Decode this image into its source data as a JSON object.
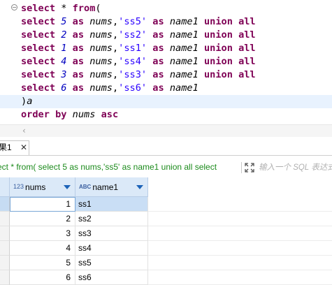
{
  "editor": {
    "lines": [
      [
        {
          "t": "select",
          "c": "kw"
        },
        {
          "t": " * ",
          "c": "op"
        },
        {
          "t": "from",
          "c": "kw"
        },
        {
          "t": "(",
          "c": "op"
        }
      ],
      [
        {
          "t": "select",
          "c": "kw"
        },
        {
          "t": " ",
          "c": "op"
        },
        {
          "t": "5",
          "c": "num"
        },
        {
          "t": " ",
          "c": "op"
        },
        {
          "t": "as",
          "c": "kw"
        },
        {
          "t": " ",
          "c": "op"
        },
        {
          "t": "nums",
          "c": "id"
        },
        {
          "t": ",",
          "c": "op"
        },
        {
          "t": "'ss5'",
          "c": "str"
        },
        {
          "t": " ",
          "c": "op"
        },
        {
          "t": "as",
          "c": "kw"
        },
        {
          "t": " ",
          "c": "op"
        },
        {
          "t": "name1",
          "c": "id"
        },
        {
          "t": " ",
          "c": "op"
        },
        {
          "t": "union",
          "c": "kw"
        },
        {
          "t": " ",
          "c": "op"
        },
        {
          "t": "all",
          "c": "kw"
        }
      ],
      [
        {
          "t": "select",
          "c": "kw"
        },
        {
          "t": " ",
          "c": "op"
        },
        {
          "t": "2",
          "c": "num"
        },
        {
          "t": " ",
          "c": "op"
        },
        {
          "t": "as",
          "c": "kw"
        },
        {
          "t": " ",
          "c": "op"
        },
        {
          "t": "nums",
          "c": "id"
        },
        {
          "t": ",",
          "c": "op"
        },
        {
          "t": "'ss2'",
          "c": "str"
        },
        {
          "t": " ",
          "c": "op"
        },
        {
          "t": "as",
          "c": "kw"
        },
        {
          "t": " ",
          "c": "op"
        },
        {
          "t": "name1",
          "c": "id"
        },
        {
          "t": " ",
          "c": "op"
        },
        {
          "t": "union",
          "c": "kw"
        },
        {
          "t": " ",
          "c": "op"
        },
        {
          "t": "all",
          "c": "kw"
        }
      ],
      [
        {
          "t": "select",
          "c": "kw"
        },
        {
          "t": " ",
          "c": "op"
        },
        {
          "t": "1",
          "c": "num"
        },
        {
          "t": " ",
          "c": "op"
        },
        {
          "t": "as",
          "c": "kw"
        },
        {
          "t": " ",
          "c": "op"
        },
        {
          "t": "nums",
          "c": "id"
        },
        {
          "t": ",",
          "c": "op"
        },
        {
          "t": "'ss1'",
          "c": "str"
        },
        {
          "t": " ",
          "c": "op"
        },
        {
          "t": "as",
          "c": "kw"
        },
        {
          "t": " ",
          "c": "op"
        },
        {
          "t": "name1",
          "c": "id"
        },
        {
          "t": " ",
          "c": "op"
        },
        {
          "t": "union",
          "c": "kw"
        },
        {
          "t": " ",
          "c": "op"
        },
        {
          "t": "all",
          "c": "kw"
        }
      ],
      [
        {
          "t": "select",
          "c": "kw"
        },
        {
          "t": " ",
          "c": "op"
        },
        {
          "t": "4",
          "c": "num"
        },
        {
          "t": " ",
          "c": "op"
        },
        {
          "t": "as",
          "c": "kw"
        },
        {
          "t": " ",
          "c": "op"
        },
        {
          "t": "nums",
          "c": "id"
        },
        {
          "t": ",",
          "c": "op"
        },
        {
          "t": "'ss4'",
          "c": "str"
        },
        {
          "t": " ",
          "c": "op"
        },
        {
          "t": "as",
          "c": "kw"
        },
        {
          "t": " ",
          "c": "op"
        },
        {
          "t": "name1",
          "c": "id"
        },
        {
          "t": " ",
          "c": "op"
        },
        {
          "t": "union",
          "c": "kw"
        },
        {
          "t": " ",
          "c": "op"
        },
        {
          "t": "all",
          "c": "kw"
        }
      ],
      [
        {
          "t": "select",
          "c": "kw"
        },
        {
          "t": " ",
          "c": "op"
        },
        {
          "t": "3",
          "c": "num"
        },
        {
          "t": " ",
          "c": "op"
        },
        {
          "t": "as",
          "c": "kw"
        },
        {
          "t": " ",
          "c": "op"
        },
        {
          "t": "nums",
          "c": "id"
        },
        {
          "t": ",",
          "c": "op"
        },
        {
          "t": "'ss3'",
          "c": "str"
        },
        {
          "t": " ",
          "c": "op"
        },
        {
          "t": "as",
          "c": "kw"
        },
        {
          "t": " ",
          "c": "op"
        },
        {
          "t": "name1",
          "c": "id"
        },
        {
          "t": " ",
          "c": "op"
        },
        {
          "t": "union",
          "c": "kw"
        },
        {
          "t": " ",
          "c": "op"
        },
        {
          "t": "all",
          "c": "kw"
        }
      ],
      [
        {
          "t": "select",
          "c": "kw"
        },
        {
          "t": " ",
          "c": "op"
        },
        {
          "t": "6",
          "c": "num"
        },
        {
          "t": " ",
          "c": "op"
        },
        {
          "t": "as",
          "c": "kw"
        },
        {
          "t": " ",
          "c": "op"
        },
        {
          "t": "nums",
          "c": "id"
        },
        {
          "t": ",",
          "c": "op"
        },
        {
          "t": "'ss6'",
          "c": "str"
        },
        {
          "t": " ",
          "c": "op"
        },
        {
          "t": "as",
          "c": "kw"
        },
        {
          "t": " ",
          "c": "op"
        },
        {
          "t": "name1",
          "c": "id"
        }
      ],
      [
        {
          "t": ")",
          "c": "op"
        },
        {
          "t": "a",
          "c": "id"
        }
      ],
      [
        {
          "t": "order",
          "c": "kw"
        },
        {
          "t": " ",
          "c": "op"
        },
        {
          "t": "by",
          "c": "kw"
        },
        {
          "t": " ",
          "c": "op"
        },
        {
          "t": "nums",
          "c": "id"
        },
        {
          "t": " ",
          "c": "op"
        },
        {
          "t": "asc",
          "c": "kw"
        }
      ]
    ],
    "current_line_index": 7,
    "fold_icon": "fold-collapse-icon",
    "scroll_left_arrow": "‹"
  },
  "result_tab": {
    "label": "果1",
    "close_glyph": "✕"
  },
  "filter_bar": {
    "query_text": "ect * from( select 5 as nums,'ss5' as name1 union all select",
    "placeholder": "输入一个 SQL 表达式",
    "expand_icon": "expand-arrows-icon"
  },
  "grid": {
    "columns": [
      {
        "type_label": "123",
        "name": "nums",
        "sort_icon": "sort-desc-icon"
      },
      {
        "type_label": "ABC",
        "name": "name1",
        "sort_icon": "sort-desc-icon"
      }
    ],
    "rows": [
      {
        "nums": "1",
        "name1": "ss1"
      },
      {
        "nums": "2",
        "name1": "ss2"
      },
      {
        "nums": "3",
        "name1": "ss3"
      },
      {
        "nums": "4",
        "name1": "ss4"
      },
      {
        "nums": "5",
        "name1": "ss5"
      },
      {
        "nums": "6",
        "name1": "ss6"
      }
    ],
    "selected_row_index": 0
  },
  "colors": {
    "keyword": "#7f0055",
    "number": "#0000c0",
    "string": "#2a00ff",
    "query_text": "#1b8a1b",
    "header_bg": "#dbe9f8",
    "selection": "#c9def5",
    "current_line": "#e8f2fe"
  }
}
